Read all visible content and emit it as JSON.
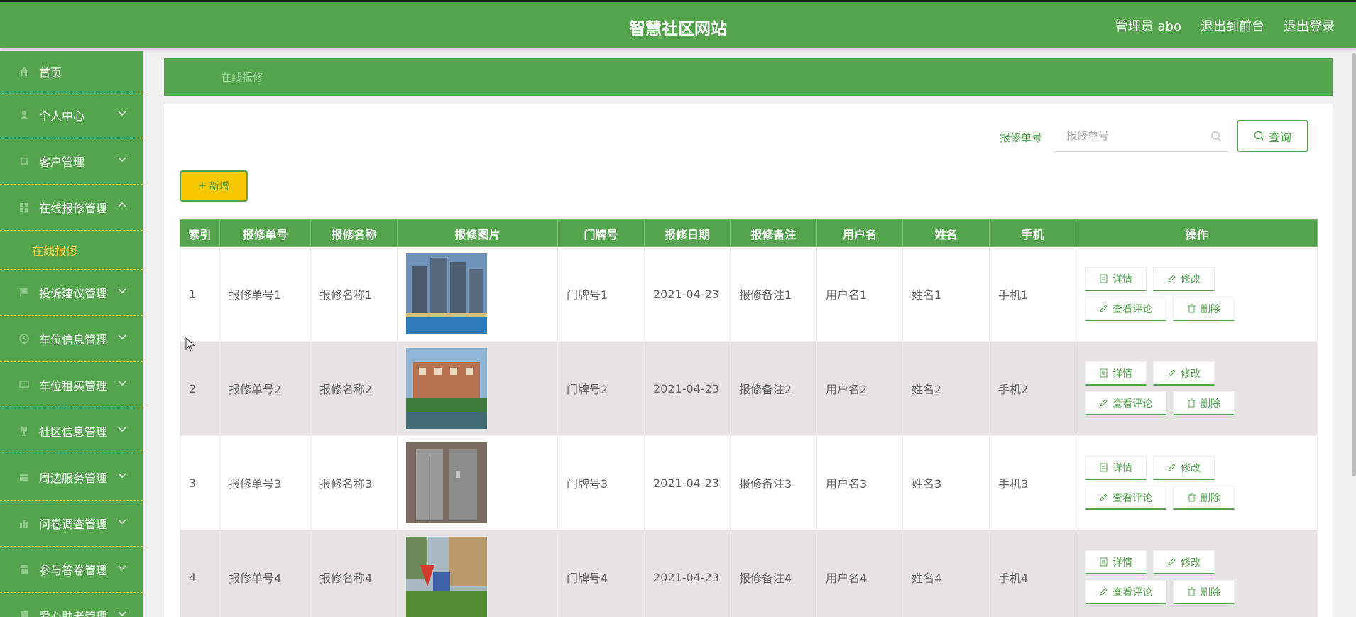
{
  "header": {
    "title": "智慧社区网站",
    "admin_label": "管理员 abo",
    "back_to_front": "退出到前台",
    "logout": "退出登录"
  },
  "sidebar": {
    "items": [
      {
        "label": "首页",
        "icon": "home-icon"
      },
      {
        "label": "个人中心",
        "icon": "user-icon"
      },
      {
        "label": "客户管理",
        "icon": "crop-icon"
      },
      {
        "label": "在线报修管理",
        "icon": "grid-icon"
      },
      {
        "label": "投诉建议管理",
        "icon": "flag-icon"
      },
      {
        "label": "车位信息管理",
        "icon": "clock-icon"
      },
      {
        "label": "车位租买管理",
        "icon": "chat-icon"
      },
      {
        "label": "社区信息管理",
        "icon": "trophy-icon"
      },
      {
        "label": "周边服务管理",
        "icon": "card-icon"
      },
      {
        "label": "问卷调查管理",
        "icon": "chart-icon"
      },
      {
        "label": "参与答卷管理",
        "icon": "shop-icon"
      },
      {
        "label": "爱心助老管理",
        "icon": "doc-icon"
      }
    ],
    "sub_active": "在线报修"
  },
  "breadcrumb": "在线报修",
  "search": {
    "label": "报修单号",
    "placeholder": "报修单号",
    "button": "查询"
  },
  "add_button": "新增",
  "table": {
    "columns": [
      "索引",
      "报修单号",
      "报修名称",
      "报修图片",
      "门牌号",
      "报修日期",
      "报修备注",
      "用户名",
      "姓名",
      "手机",
      "操作"
    ],
    "rows": [
      {
        "index": "1",
        "no": "报修单号1",
        "name": "报修名称1",
        "door": "门牌号1",
        "date": "2021-04-23",
        "remark": "报修备注1",
        "username": "用户名1",
        "realname": "姓名1",
        "phone": "手机1"
      },
      {
        "index": "2",
        "no": "报修单号2",
        "name": "报修名称2",
        "door": "门牌号2",
        "date": "2021-04-23",
        "remark": "报修备注2",
        "username": "用户名2",
        "realname": "姓名2",
        "phone": "手机2"
      },
      {
        "index": "3",
        "no": "报修单号3",
        "name": "报修名称3",
        "door": "门牌号3",
        "date": "2021-04-23",
        "remark": "报修备注3",
        "username": "用户名3",
        "realname": "姓名3",
        "phone": "手机3"
      },
      {
        "index": "4",
        "no": "报修单号4",
        "name": "报修名称4",
        "door": "门牌号4",
        "date": "2021-04-23",
        "remark": "报修备注4",
        "username": "用户名4",
        "realname": "姓名4",
        "phone": "手机4"
      }
    ],
    "ops": {
      "detail": "详情",
      "edit": "修改",
      "comments": "查看评论",
      "delete": "删除"
    }
  },
  "colors": {
    "primary": "#53a44d",
    "accent": "#f7c700",
    "submenu": "#f4d03f",
    "alt_row": "#e5e3e3"
  }
}
